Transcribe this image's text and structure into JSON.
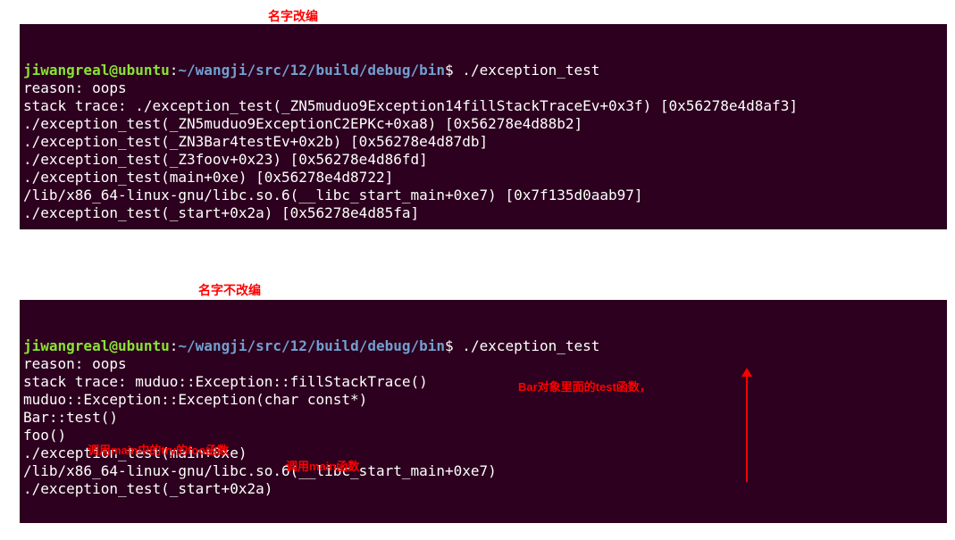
{
  "labels": {
    "top": "名字改编",
    "bottom": "名字不改编"
  },
  "annotations": {
    "bar_test": "Bar对象里面的test函数，",
    "foo_call": "调用main中的try的foo函数",
    "main_call": "调用main函数"
  },
  "terminal1": {
    "prompt_user": "jiwangreal@ubuntu",
    "prompt_sep": ":",
    "prompt_path": "~/wangji/src/12/build/debug/bin",
    "prompt_dollar": "$",
    "command": " ./exception_test",
    "lines": [
      "reason: oops",
      "stack trace: ./exception_test(_ZN5muduo9Exception14fillStackTraceEv+0x3f) [0x56278e4d8af3]",
      "./exception_test(_ZN5muduo9ExceptionC2EPKc+0xa8) [0x56278e4d88b2]",
      "./exception_test(_ZN3Bar4testEv+0x2b) [0x56278e4d87db]",
      "./exception_test(_Z3foov+0x23) [0x56278e4d86fd]",
      "./exception_test(main+0xe) [0x56278e4d8722]",
      "/lib/x86_64-linux-gnu/libc.so.6(__libc_start_main+0xe7) [0x7f135d0aab97]",
      "./exception_test(_start+0x2a) [0x56278e4d85fa]"
    ]
  },
  "terminal2": {
    "prompt_user": "jiwangreal@ubuntu",
    "prompt_sep": ":",
    "prompt_path": "~/wangji/src/12/build/debug/bin",
    "prompt_dollar": "$",
    "command": " ./exception_test",
    "lines": [
      "reason: oops",
      "stack trace: muduo::Exception::fillStackTrace()",
      "muduo::Exception::Exception(char const*)",
      "Bar::test()",
      "foo()",
      "./exception_test(main+0xe)",
      "/lib/x86_64-linux-gnu/libc.so.6(__libc_start_main+0xe7)",
      "./exception_test(_start+0x2a)"
    ]
  }
}
